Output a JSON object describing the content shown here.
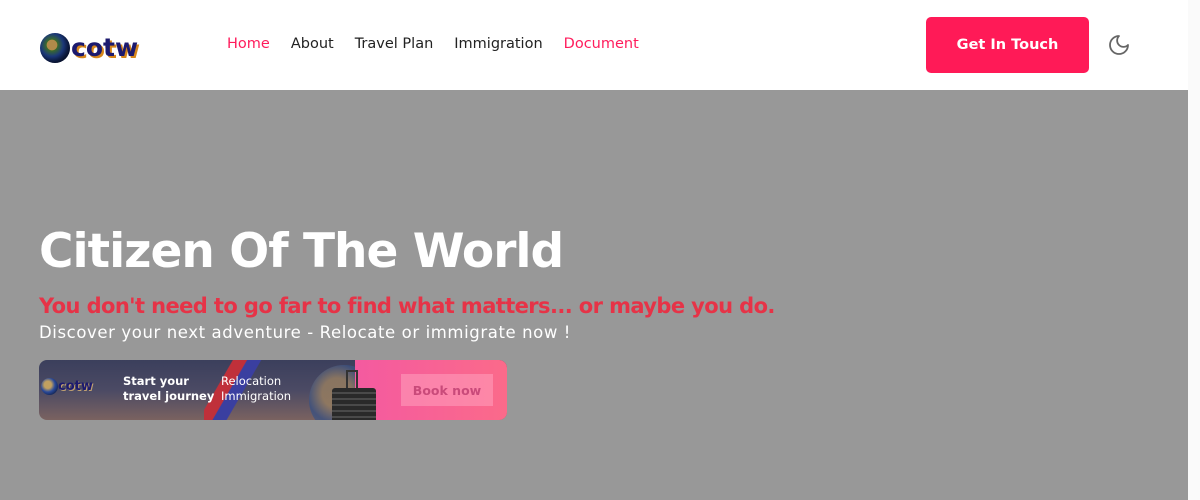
{
  "header": {
    "logo_text": "cotw",
    "nav": [
      {
        "label": "Home",
        "active": true
      },
      {
        "label": "About",
        "active": false
      },
      {
        "label": "Travel Plan",
        "active": false
      },
      {
        "label": "Immigration",
        "active": false
      },
      {
        "label": "Document",
        "active": true
      }
    ],
    "cta_label": "Get In Touch",
    "theme_toggle_icon": "moon-icon"
  },
  "hero": {
    "title": "Citizen Of The World",
    "tagline": "You don't need to go far to find what matters... or maybe you do.",
    "subtitle": "Discover your next adventure - Relocate or immigrate now !"
  },
  "banner": {
    "logo_text": "cotw",
    "headline_line1": "Start your",
    "headline_line2": "travel journey",
    "service_1": "Relocation",
    "service_2": "Immigration",
    "button_label": "Book now"
  },
  "colors": {
    "accent": "#ff1a57",
    "tagline": "#e63347",
    "hero_bg": "#989898",
    "logo_text": "#1c1a6e"
  }
}
